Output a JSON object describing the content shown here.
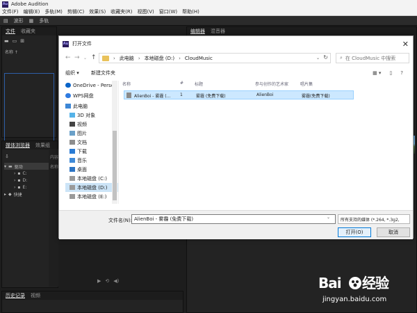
{
  "app": {
    "title": "Adobe Audition",
    "logo": "Au",
    "menu": [
      "文件(F)",
      "编辑(E)",
      "多轨(M)",
      "剪辑(C)",
      "效果(S)",
      "收藏夹(R)",
      "视图(V)",
      "窗口(W)",
      "帮助(H)"
    ],
    "toolbar": {
      "waveform": "波形",
      "multitrack": "多轨"
    }
  },
  "panels": {
    "files": {
      "tabs": [
        "文件",
        "收藏夹"
      ],
      "col_name": "名称 ↑"
    },
    "media": {
      "tabs": [
        "媒体浏览器",
        "效果组"
      ],
      "tree": [
        "驱动",
        "C:",
        "D:",
        "E:",
        "快捷"
      ],
      "right_head": [
        "内容",
        "名称"
      ]
    },
    "history": {
      "tabs": [
        "历史记录",
        "视频"
      ]
    },
    "editor": {
      "tabs": [
        "编辑器",
        "混音器"
      ]
    }
  },
  "dialog": {
    "title": "打开文件",
    "path": [
      "此电脑",
      "本地磁盘 (D:)",
      "CloudMusic"
    ],
    "search_placeholder": "在 CloudMusic 中搜索",
    "organize": "组织 ▾",
    "new_folder": "新建文件夹",
    "nav": [
      {
        "label": "OneDrive - Perso",
        "icon": "onedrive-icon"
      },
      {
        "label": "WPS网盘",
        "icon": "cloud-icon"
      },
      {
        "label": "此电脑",
        "icon": "computer-icon"
      },
      {
        "label": "3D 对象",
        "icon": "cube-icon"
      },
      {
        "label": "视频",
        "icon": "video-icon"
      },
      {
        "label": "图片",
        "icon": "picture-icon"
      },
      {
        "label": "文档",
        "icon": "document-icon"
      },
      {
        "label": "下载",
        "icon": "download-icon"
      },
      {
        "label": "音乐",
        "icon": "music-icon"
      },
      {
        "label": "桌面",
        "icon": "desktop-icon"
      },
      {
        "label": "本地磁盘 (C:)",
        "icon": "drive-icon"
      },
      {
        "label": "本地磁盘 (D:)",
        "icon": "drive-icon",
        "selected": true
      },
      {
        "label": "本地磁盘 (E:)",
        "icon": "drive-icon"
      }
    ],
    "columns": [
      "名称",
      "#",
      "标题",
      "参与创作的艺术家",
      "唱片集"
    ],
    "file": {
      "name": "AlienBoi - 雾霾 (...",
      "number": "1",
      "title": "雾霾 (免费下载)",
      "artist": "AlienBoi",
      "album": "雾霾(免费下载)"
    },
    "filename_label": "文件名(N):",
    "filename_value": "AlienBoi - 雾霾 (免费下载)",
    "filter": "所有支持的媒体 (*.264, *.3g2,",
    "open": "打开(O)",
    "cancel": "取消"
  },
  "watermark": {
    "logo": "Bai du 经验",
    "url": "jingyan.baidu.com"
  },
  "colors": {
    "accent": "#2d5ea7",
    "dialog_selection": "#cce8ff",
    "app_bg": "#1d1d1d"
  }
}
